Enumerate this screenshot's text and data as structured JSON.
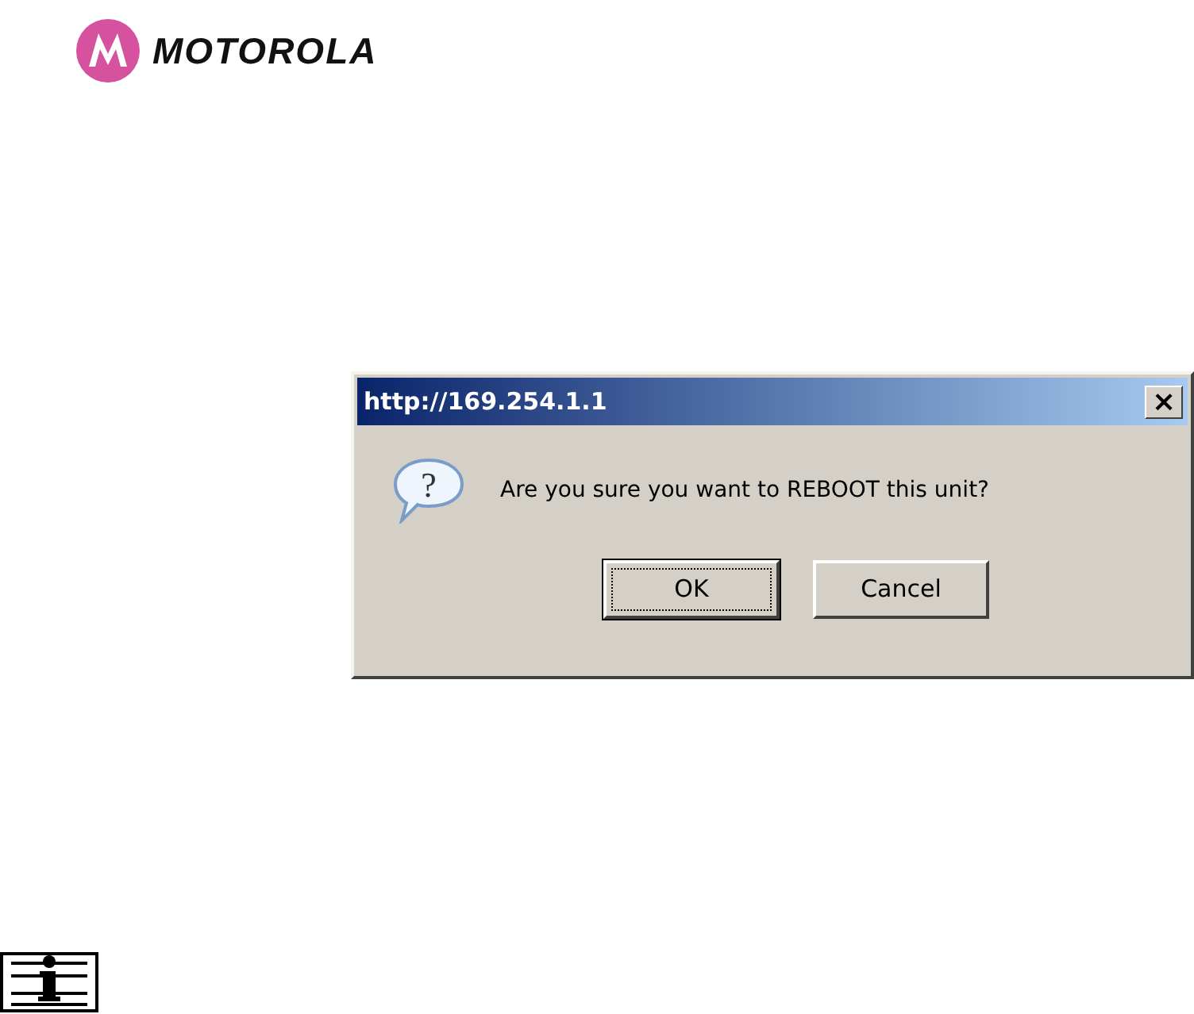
{
  "logo": {
    "text": "MOTOROLA"
  },
  "dialog": {
    "title": "http://169.254.1.1",
    "close": "×",
    "icon_glyph": "?",
    "message": "Are you sure you want to REBOOT this unit?",
    "buttons": [
      {
        "label": "OK",
        "focused": true
      },
      {
        "label": "Cancel",
        "focused": false
      }
    ]
  },
  "note_icon": {
    "kind": "info"
  }
}
